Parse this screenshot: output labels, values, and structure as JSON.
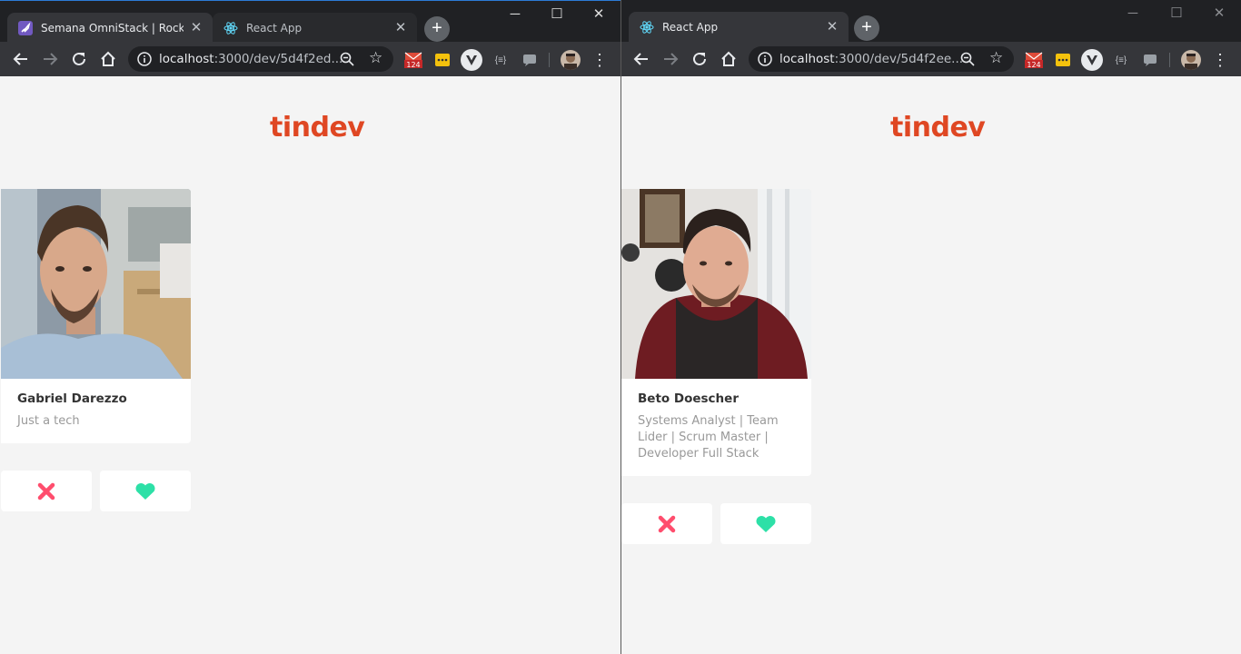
{
  "left_window": {
    "tabs": [
      {
        "title": "Semana OmniStack | Rocketseat",
        "active": true,
        "favicon": "rocket-icon"
      },
      {
        "title": "React App",
        "active": false,
        "favicon": "react-icon"
      }
    ],
    "url_host": "localhost",
    "url_rest": ":3000/dev/5d4f2ed...",
    "ext_badge": "124",
    "app": {
      "logo": "tindev",
      "user": {
        "name": "Gabriel Darezzo",
        "bio": "Just a tech"
      }
    }
  },
  "right_window": {
    "tabs": [
      {
        "title": "React App",
        "active": true,
        "favicon": "react-icon"
      }
    ],
    "url_host": "localhost",
    "url_rest": ":3000/dev/5d4f2ee...",
    "ext_badge": "124",
    "app": {
      "logo": "tindev",
      "user": {
        "name": "Beto Doescher",
        "bio": "Systems Analyst | Team Lider | Scrum Master | Developer Full Stack"
      }
    }
  },
  "colors": {
    "logo": "#df4723",
    "dislike": "#ff4d6d",
    "like": "#2de0a7",
    "background": "#f4f4f4"
  }
}
